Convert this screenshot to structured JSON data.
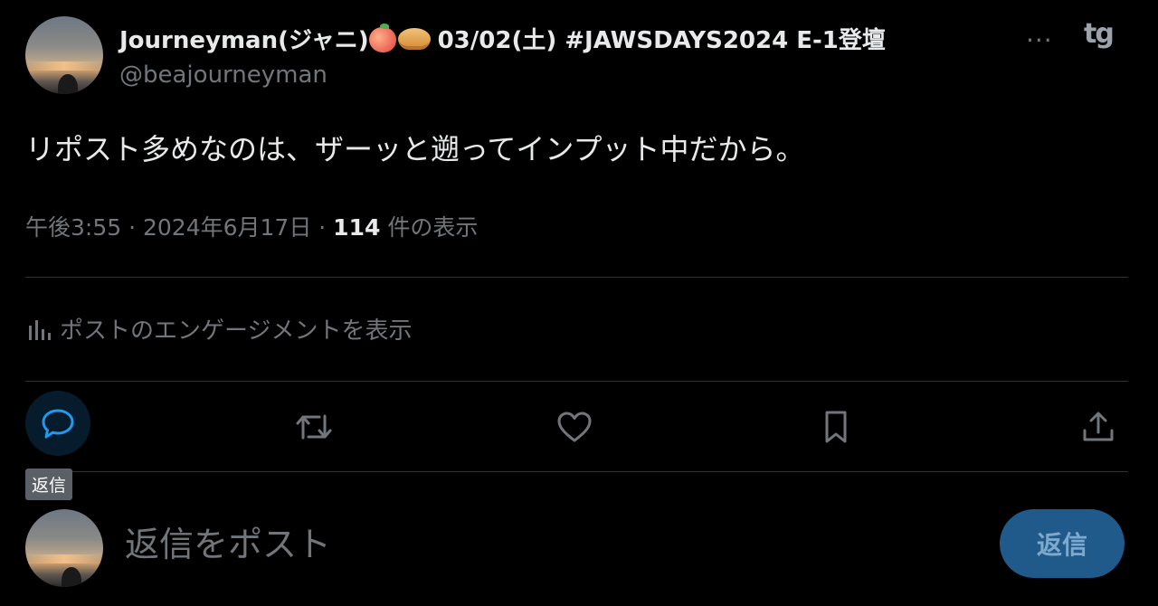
{
  "author": {
    "display_name_prefix": "Journeyman(ジャニ)",
    "display_name_suffix": "03/02(土) #JAWSDAYS2024 E-1登壇",
    "emojis": [
      "peach-emoji",
      "pie-emoji"
    ],
    "handle": "@beajourneyman"
  },
  "header": {
    "more_label": "···",
    "app_logo": "tg"
  },
  "post": {
    "text": "リポスト多めなのは、ザーッと遡ってインプット中だから。",
    "time": "午後3:55",
    "date": "2024年6月17日",
    "separator": " · ",
    "views_count": "114",
    "views_label": "件の表示"
  },
  "engagement": {
    "label": "ポストのエンゲージメントを表示",
    "icon": "bar-chart-icon"
  },
  "actions": {
    "reply_icon": "comment-icon",
    "retweet_icon": "repost-icon",
    "like_icon": "heart-icon",
    "bookmark_icon": "bookmark-icon",
    "share_icon": "share-icon",
    "reply_tooltip": "返信"
  },
  "composer": {
    "placeholder": "返信をポスト",
    "button_label": "返信"
  },
  "colors": {
    "background": "#000000",
    "text_primary": "#e7e9ea",
    "text_secondary": "#71767b",
    "accent": "#1d9bf0",
    "reply_button_bg": "#1f5a8a",
    "divider": "#2f3336"
  }
}
